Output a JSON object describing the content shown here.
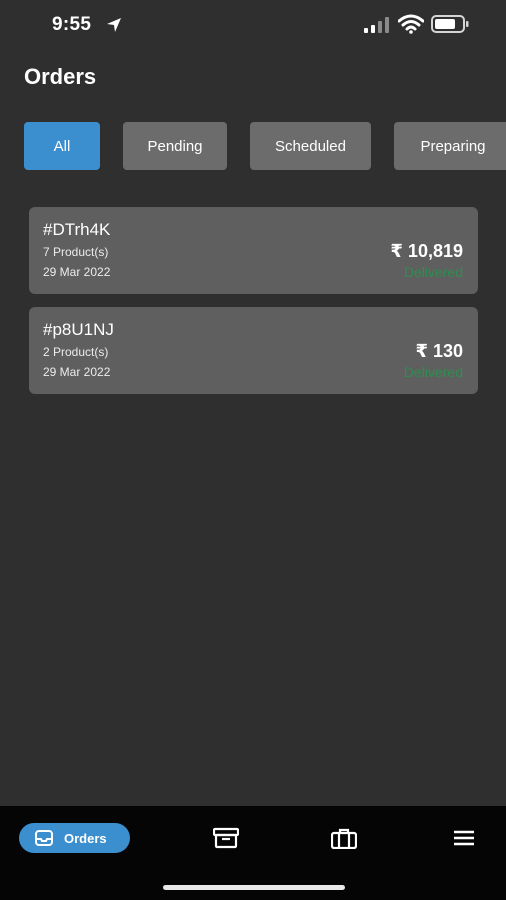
{
  "status_bar": {
    "time": "9:55"
  },
  "page": {
    "title": "Orders"
  },
  "filters": [
    {
      "label": "All",
      "active": true
    },
    {
      "label": "Pending",
      "active": false
    },
    {
      "label": "Scheduled",
      "active": false
    },
    {
      "label": "Preparing",
      "active": false
    }
  ],
  "orders": [
    {
      "id": "#DTrh4K",
      "products": "7 Product(s)",
      "date": "29 Mar 2022",
      "amount": "₹ 10,819",
      "status": "Delivered"
    },
    {
      "id": "#p8U1NJ",
      "products": "2 Product(s)",
      "date": "29 Mar 2022",
      "amount": "₹ 130",
      "status": "Delivered"
    }
  ],
  "nav": {
    "orders_label": "Orders",
    "icons": [
      "inbox-icon",
      "archive-icon",
      "briefcase-icon",
      "menu-icon"
    ]
  },
  "colors": {
    "accent": "#3b8fcf",
    "delivered": "#2e8e4f",
    "background": "#2f2f2f",
    "card": "#5f5f5f"
  }
}
